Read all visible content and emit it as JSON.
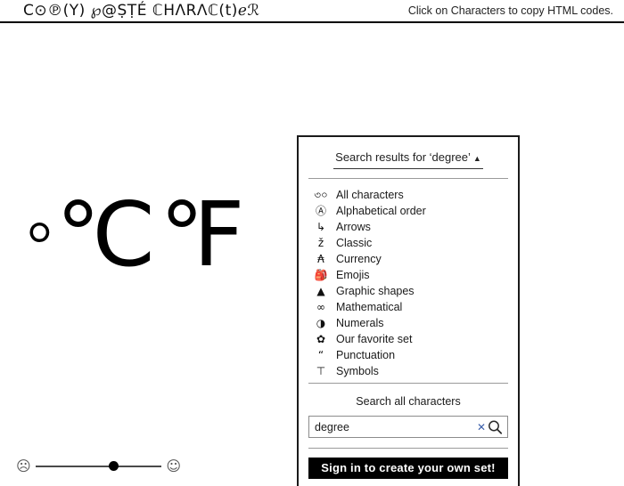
{
  "header": {
    "logo": "C⊙℗(Y) ℘@ṢṬÉ ℂHΛRΛℂ(t)ℯℛ",
    "tagline": "Click on Characters to copy HTML codes."
  },
  "main": {
    "characters": [
      {
        "glyph": "°",
        "name": "degree-sign",
        "size": "small"
      },
      {
        "glyph": "℃",
        "name": "degree-celsius",
        "size": "large"
      },
      {
        "glyph": "℉",
        "name": "degree-fahrenheit",
        "size": "large"
      }
    ]
  },
  "feedback": {
    "sad_icon": "☹",
    "happy_icon": "☺",
    "value": 50
  },
  "panel": {
    "header_title": "Search results for ‘degree’",
    "header_caret": "▲",
    "categories": [
      {
        "icon": "৩০",
        "label": "All characters",
        "key": "all-characters"
      },
      {
        "icon": "Ⓐ",
        "label": "Alphabetical order",
        "key": "alphabetical-order"
      },
      {
        "icon": "↳",
        "label": "Arrows",
        "key": "arrows"
      },
      {
        "icon": "ž",
        "label": "Classic",
        "key": "classic"
      },
      {
        "icon": "₳",
        "label": "Currency",
        "key": "currency"
      },
      {
        "icon": "🎒",
        "label": "Emojis",
        "key": "emojis"
      },
      {
        "icon": "▲",
        "label": "Graphic shapes",
        "key": "graphic-shapes"
      },
      {
        "icon": "∞",
        "label": "Mathematical",
        "key": "mathematical"
      },
      {
        "icon": "◑",
        "label": "Numerals",
        "key": "numerals"
      },
      {
        "icon": "✿",
        "label": "Our favorite set",
        "key": "our-favorite-set"
      },
      {
        "icon": "“",
        "label": "Punctuation",
        "key": "punctuation"
      },
      {
        "icon": "⊤",
        "label": "Symbols",
        "key": "symbols"
      }
    ],
    "search": {
      "title": "Search all characters",
      "value": "degree",
      "placeholder": "Search all characters",
      "clear_icon": "✕",
      "submit_icon": "search-icon"
    },
    "signin_label": "Sign in to create your own set!"
  },
  "colors": {
    "accent": "#3b5faa",
    "panel_border": "#1a1a1a",
    "button_background": "#000000",
    "text": "#1a1a1a"
  }
}
